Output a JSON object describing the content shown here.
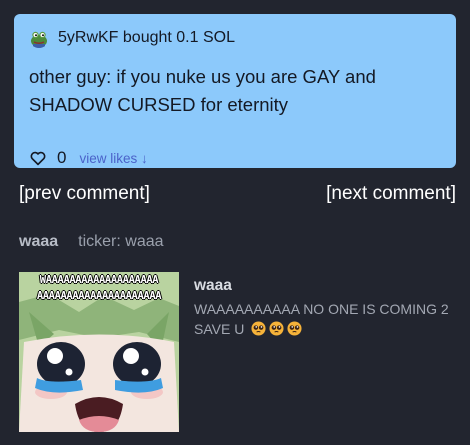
{
  "colors": {
    "page_bg": "#22252f",
    "card_bg": "#8cc9fb",
    "card_text": "#141924",
    "link": "#4a62c9",
    "muted_text": "#9aa0ac"
  },
  "comment": {
    "avatar_icon": "pepe-frog-avatar-icon",
    "user_action": "5yRwKF bought 0.1 SOL",
    "text": "other guy: if you nuke us you are GAY and SHADOW CURSED for eternity",
    "like_icon": "heart-outline-icon",
    "like_count": "0",
    "view_likes": "view likes ↓"
  },
  "nav": {
    "prev": "[prev comment]",
    "next": "[next comment]"
  },
  "token": {
    "name": "waaa",
    "ticker": "ticker: waaa",
    "image_icon": "crying-anime-meme-image",
    "image_caption_line1": "WAAAAAAAAAAAAAAAAAAA",
    "image_caption_line2": "AAAAAAAAAAAAAAAAAAAAA",
    "title": "waaa",
    "description": "WAAAAAAAAAA NO ONE IS COMING 2 SAVE U",
    "description_emoji": "pleading-face-emoji"
  }
}
